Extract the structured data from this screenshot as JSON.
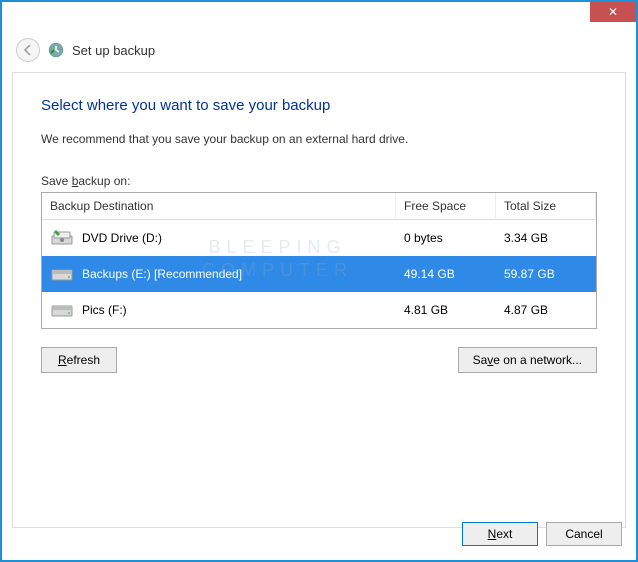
{
  "titlebar": {
    "close_symbol": "✕"
  },
  "header": {
    "title": "Set up backup"
  },
  "main": {
    "heading": "Select where you want to save your backup",
    "subtext": "We recommend that you save your backup on an external hard drive.",
    "label_prefix": "Save ",
    "label_underlined": "b",
    "label_suffix": "ackup on:",
    "columns": {
      "dest": "Backup Destination",
      "free": "Free Space",
      "total": "Total Size"
    },
    "drives": [
      {
        "name": "DVD Drive (D:)",
        "free": "0 bytes",
        "total": "3.34 GB",
        "selected": false,
        "icon": "dvd"
      },
      {
        "name": "Backups (E:) [Recommended]",
        "free": "49.14 GB",
        "total": "59.87 GB",
        "selected": true,
        "icon": "hdd"
      },
      {
        "name": "Pics (F:)",
        "free": "4.81 GB",
        "total": "4.87 GB",
        "selected": false,
        "icon": "hdd"
      }
    ],
    "refresh_underlined": "R",
    "refresh_suffix": "efresh",
    "network_prefix": "Sa",
    "network_underlined": "v",
    "network_suffix": "e on a network..."
  },
  "footer": {
    "next_underlined": "N",
    "next_suffix": "ext",
    "cancel": "Cancel"
  },
  "watermark": {
    "line1": "BLEEPING",
    "line2": "COMPUTER"
  }
}
